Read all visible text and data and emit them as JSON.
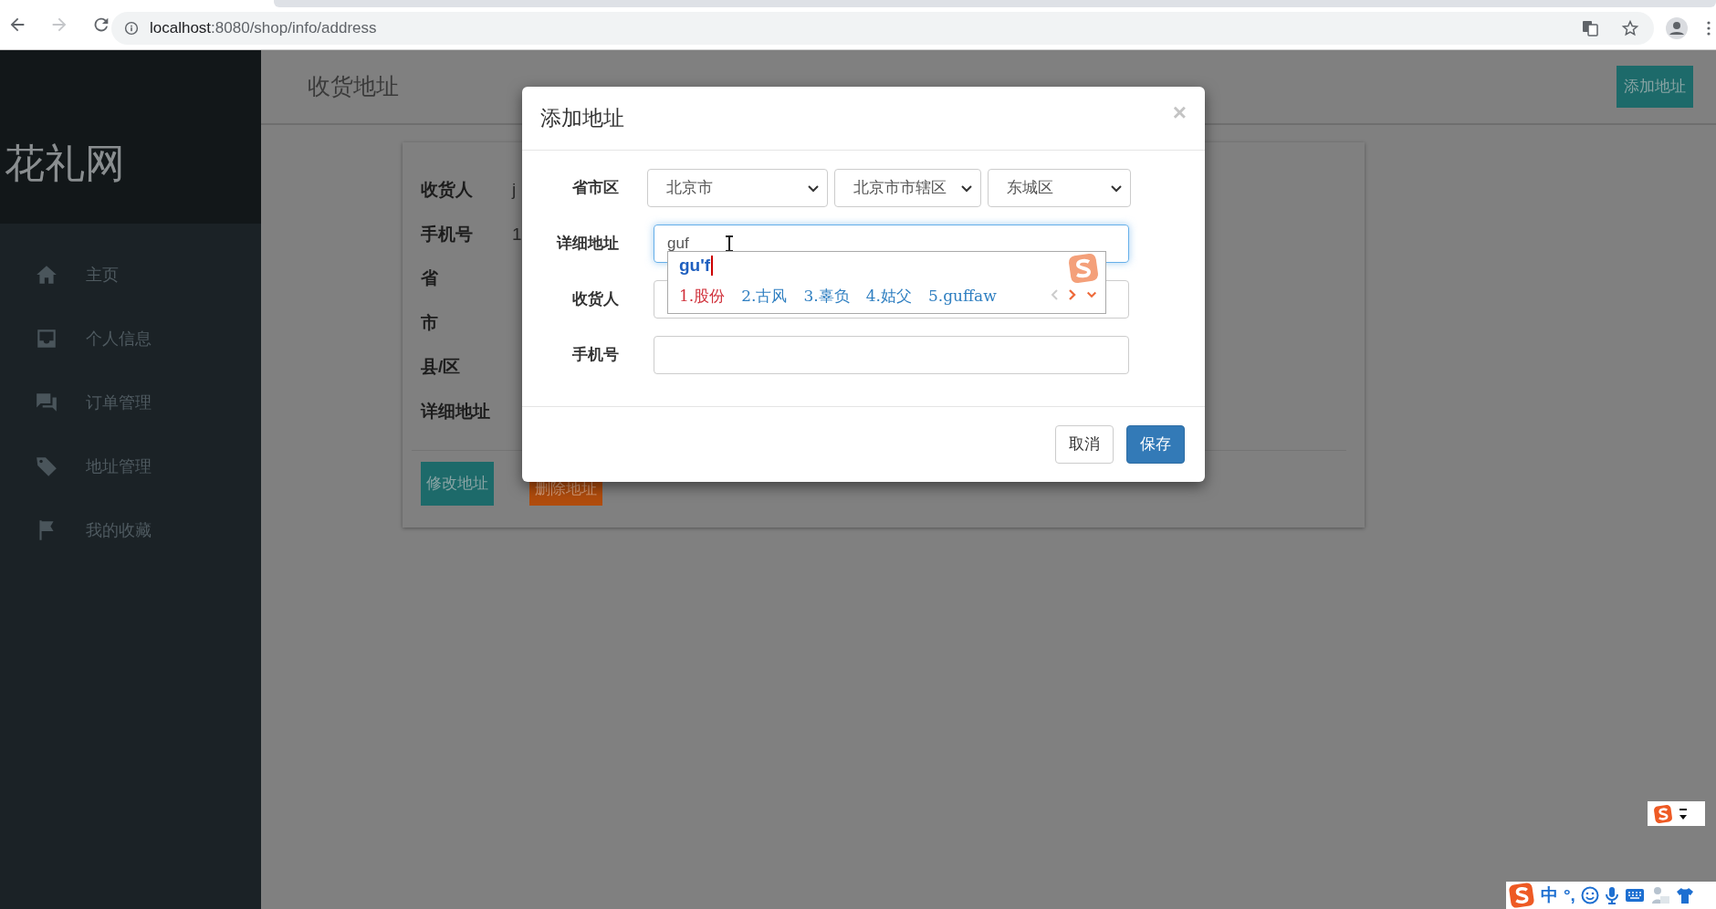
{
  "browser": {
    "url_host": "localhost",
    "url_path": ":8080/shop/info/address"
  },
  "sidebar": {
    "logo": "花礼网",
    "items": [
      {
        "label": "主页"
      },
      {
        "label": "个人信息"
      },
      {
        "label": "订单管理"
      },
      {
        "label": "地址管理"
      },
      {
        "label": "我的收藏"
      }
    ]
  },
  "page": {
    "title": "收货地址",
    "add_button": "添加地址"
  },
  "card": {
    "fields": [
      {
        "label": "收货人",
        "value": "j"
      },
      {
        "label": "手机号",
        "value": "1"
      },
      {
        "label": "省"
      },
      {
        "label": "市"
      },
      {
        "label": "县/区"
      },
      {
        "label": "详细地址"
      }
    ],
    "buttons": [
      {
        "label": "修改地址",
        "kind": "edit"
      },
      {
        "label": "删除地址",
        "kind": "delete"
      }
    ]
  },
  "modal": {
    "title": "添加地址",
    "close": "×",
    "rows": [
      {
        "label": "省市区",
        "kind": "selects",
        "selects": [
          "北京市",
          "北京市市辖区",
          "东城区"
        ]
      },
      {
        "label": "详细地址",
        "kind": "input",
        "value": "guf",
        "focused": true
      },
      {
        "label": "收货人",
        "kind": "input",
        "focused": false
      },
      {
        "label": "手机号",
        "kind": "input",
        "focused": false
      }
    ],
    "buttons": [
      {
        "label": "取消",
        "kind": "default"
      },
      {
        "label": "保存",
        "kind": "primary"
      }
    ]
  },
  "ime": {
    "composition": "gu'f",
    "candidates": [
      {
        "text": "1.股份",
        "selected": true
      },
      {
        "text": "2.古风",
        "selected": false
      },
      {
        "text": "3.辜负",
        "selected": false
      },
      {
        "text": "4.姑父",
        "selected": false
      },
      {
        "text": "5.guffaw",
        "selected": false
      }
    ]
  },
  "ime_toolbar": {
    "items": [
      "中",
      "°,"
    ]
  }
}
